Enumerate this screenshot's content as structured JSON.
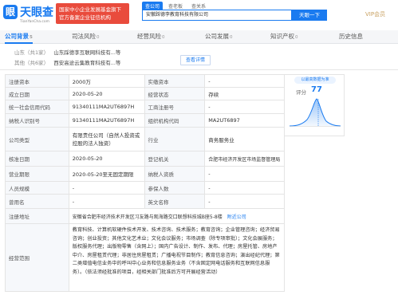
{
  "header": {
    "logo_glyph": "眼",
    "logo_name": "天眼查",
    "logo_sub": "TianYanCha.com",
    "promo_line1": "国家中小企业发展基金旗下",
    "promo_line2": "官方备案企业征信机构",
    "search_tabs": [
      "查公司",
      "查老板",
      "查关系"
    ],
    "search_value": "安徽踩德李教育科技有限公司",
    "search_button": "天眼一下",
    "vip_label": "VIP会员"
  },
  "nav": {
    "tabs": [
      {
        "label": "公司背景",
        "count": "5"
      },
      {
        "label": "司法风险",
        "count": "0"
      },
      {
        "label": "经营风险",
        "count": "0"
      },
      {
        "label": "公司发展",
        "count": "0"
      },
      {
        "label": "知识产权",
        "count": "0"
      },
      {
        "label": "历史信息",
        "count": ""
      }
    ]
  },
  "shareholders": {
    "rows": [
      {
        "province": "山东",
        "count": "（共1家）",
        "name": "山东踩德李互联网科技有...等"
      },
      {
        "province": "其他",
        "count": "（共6家）",
        "name": "西安高途云集教育科技有...等"
      }
    ],
    "view_details": "查看详情"
  },
  "score": {
    "badge": "以最高数据为准",
    "label": "评分",
    "value": "77"
  },
  "info": {
    "reg_capital_label": "注册资本",
    "reg_capital": "2000万",
    "paid_capital_label": "实缴资本",
    "paid_capital": "-",
    "founded_label": "成立日期",
    "founded": "2020-05-20",
    "status_label": "经营状态",
    "status": "存续",
    "credit_code_label": "统一社会信用代码",
    "credit_code": "91340111MA2UT6897H",
    "biz_reg_label": "工商注册号",
    "biz_reg": "-",
    "tax_id_label": "纳税人识别号",
    "tax_id": "91340111MA2UT6897H",
    "org_code_label": "组织机构代码",
    "org_code": "MA2UT6897",
    "type_label": "公司类型",
    "type": "有限责任公司（自然人投资或控股的法人独资）",
    "industry_label": "行业",
    "industry": "商务服务业",
    "approval_label": "核准日期",
    "approval": "2020-05-20",
    "authority_label": "登记机关",
    "authority": "合肥市经济开发区市场监督管理局",
    "term_label": "营业期限",
    "term": "2020-05-20至无固定期限",
    "taxpayer_label": "纳税人资质",
    "taxpayer": "-",
    "staff_label": "人员规模",
    "staff": "-",
    "insured_label": "参保人数",
    "insured": "-",
    "former_name_label": "曾用名",
    "former_name": "-",
    "english_name_label": "英文名称",
    "english_name": "-",
    "address_label": "注册地址",
    "address": "安徽省合肥市经济技术开发区习友路与观海路交口联想科技城B座5-8楼",
    "address_link": "附近公司",
    "scope_label": "经营范围",
    "scope": "教育科技、计算机软硬件技术开发、技术咨询、技术服务；教育咨询；企业管理咨询；经济贸易咨询；创业投资；其他文化艺术业；文化会议服务；市场调查（除专项审批）；文化会展服务；版权服务代理；出版物零售（含网上）；国内广告设计、制作、发布、代理；房屋托管、房地产中介、房屋租赁代理；非居住房屋租赁；广播电视节目制作；教育信息咨询；演出经纪代理；第二类增值电信业务中的呼叫中心业务和信息服务业务（不含固定网电话服务和互联网信息服务）。（依法须经批准的项目，经相关部门批准后方可开展经营活动）"
  }
}
